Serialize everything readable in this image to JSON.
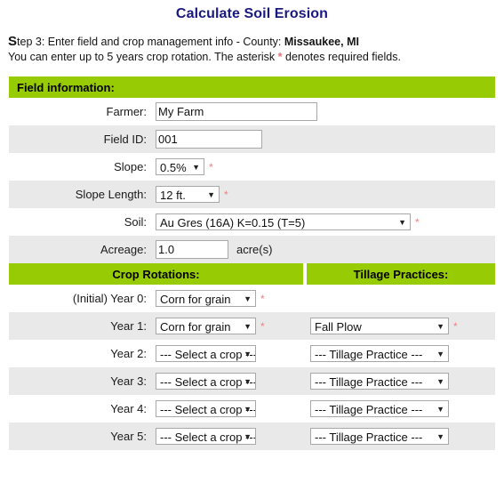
{
  "page": {
    "title": "Calculate Soil Erosion",
    "step_prefix_letter": "S",
    "step_text_1": "tep 3: Enter field and crop management info - County: ",
    "county": "Missaukee, MI",
    "note_part_1": "You can enter up to 5 years crop rotation. The asterisk ",
    "note_asterisk": "*",
    "note_part_2": " denotes required fields.",
    "required_marker": "*"
  },
  "colors": {
    "title": "#191980",
    "header_bar": "#97cc05",
    "row_alt": "#e9e9e9",
    "required": "#f08080"
  },
  "field_information": {
    "section_label": "Field information:",
    "rows": [
      {
        "label": "Farmer:",
        "value": "My Farm",
        "required": "",
        "unit": ""
      },
      {
        "label": "Field ID:",
        "value": "001",
        "required": "",
        "unit": ""
      },
      {
        "label": "Slope:",
        "value": "0.5%",
        "required": "*",
        "unit": ""
      },
      {
        "label": "Slope Length:",
        "value": "12 ft.",
        "required": "*",
        "unit": ""
      },
      {
        "label": "Soil:",
        "value": "Au Gres (16A) K=0.15 (T=5)",
        "required": "*",
        "unit": ""
      },
      {
        "label": "Acreage:",
        "value": "1.0",
        "required": "",
        "unit": "acre(s)"
      }
    ]
  },
  "rotation_section": {
    "crop_header": "Crop Rotations:",
    "tillage_header": "Tillage Practices:",
    "rows": [
      {
        "label": "(Initial) Year 0:",
        "crop": "Corn for grain",
        "crop_required": "*",
        "tillage": "",
        "tillage_required": ""
      },
      {
        "label": "Year 1:",
        "crop": "Corn for grain",
        "crop_required": "*",
        "tillage": "Fall Plow",
        "tillage_required": "*"
      },
      {
        "label": "Year 2:",
        "crop": "--- Select a crop ---",
        "crop_required": "",
        "tillage": "--- Tillage Practice ---",
        "tillage_required": ""
      },
      {
        "label": "Year 3:",
        "crop": "--- Select a crop ---",
        "crop_required": "",
        "tillage": "--- Tillage Practice ---",
        "tillage_required": ""
      },
      {
        "label": "Year 4:",
        "crop": "--- Select a crop ---",
        "crop_required": "",
        "tillage": "--- Tillage Practice ---",
        "tillage_required": ""
      },
      {
        "label": "Year 5:",
        "crop": "--- Select a crop ---",
        "crop_required": "",
        "tillage": "--- Tillage Practice ---",
        "tillage_required": ""
      }
    ]
  },
  "icons": {
    "dropdown_arrow": "▼"
  }
}
